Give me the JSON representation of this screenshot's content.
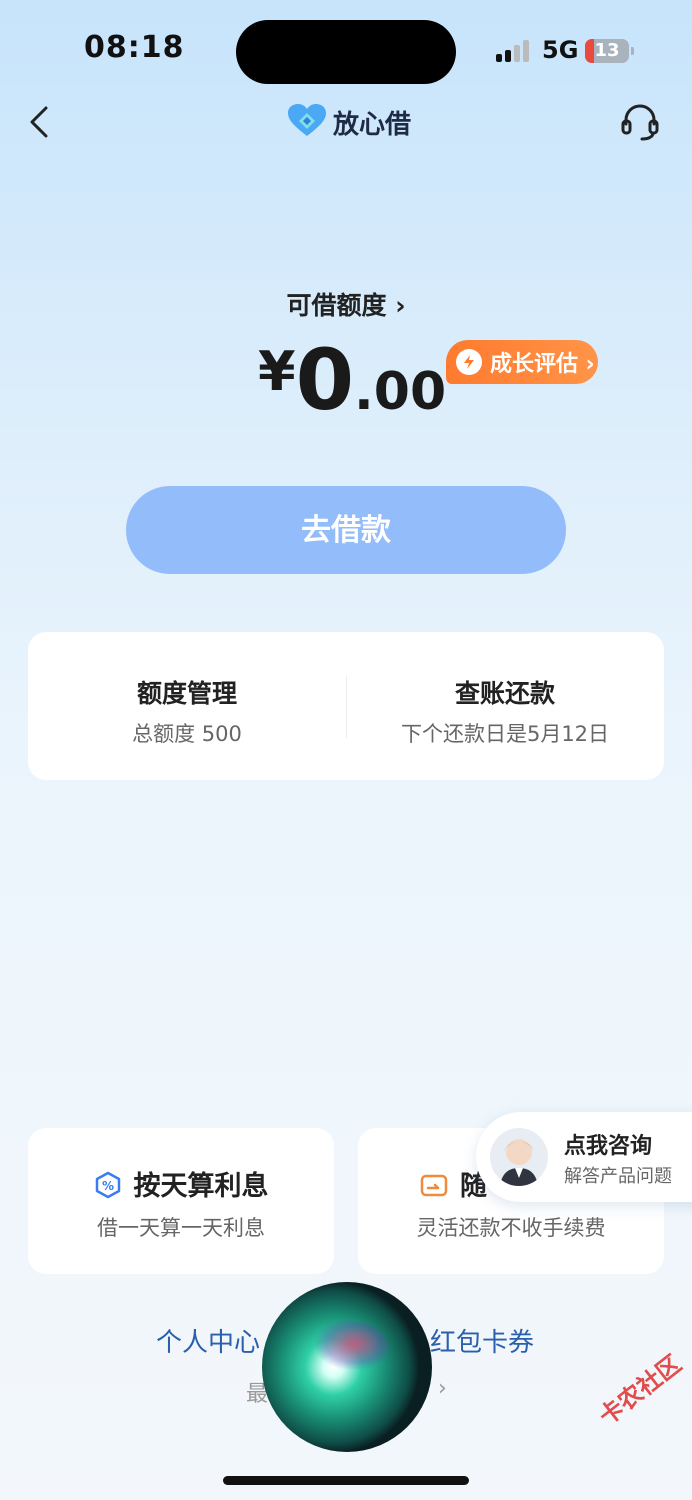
{
  "status_bar": {
    "time": "08:18",
    "network": "5G",
    "battery": "13"
  },
  "nav": {
    "brand": "放心借"
  },
  "credit": {
    "label": "可借额度 ›",
    "currency": "¥",
    "amount_int": "0",
    "amount_dec": ".00",
    "growth_badge": "成长评估 ›"
  },
  "borrow_button": "去借款",
  "cards": {
    "quota": {
      "title": "额度管理",
      "subtitle": "总额度 500"
    },
    "bill": {
      "title": "查账还款",
      "subtitle": "下个还款日是5月12日"
    }
  },
  "features": [
    {
      "title": "按天算利息",
      "subtitle": "借一天算一天利息"
    },
    {
      "title": "随",
      "subtitle": "灵活还款不收手续费"
    }
  ],
  "consult": {
    "title": "点我咨询",
    "subtitle": "解答产品问题"
  },
  "links": {
    "personal_center": "个人中心",
    "coupons": "红包卡券",
    "recent": "最",
    "recent_arrow": "›"
  },
  "watermark": "卡农社区",
  "colors": {
    "accent": "#93bcfb",
    "orange": "#ff7a2e",
    "link": "#2a5fae"
  }
}
